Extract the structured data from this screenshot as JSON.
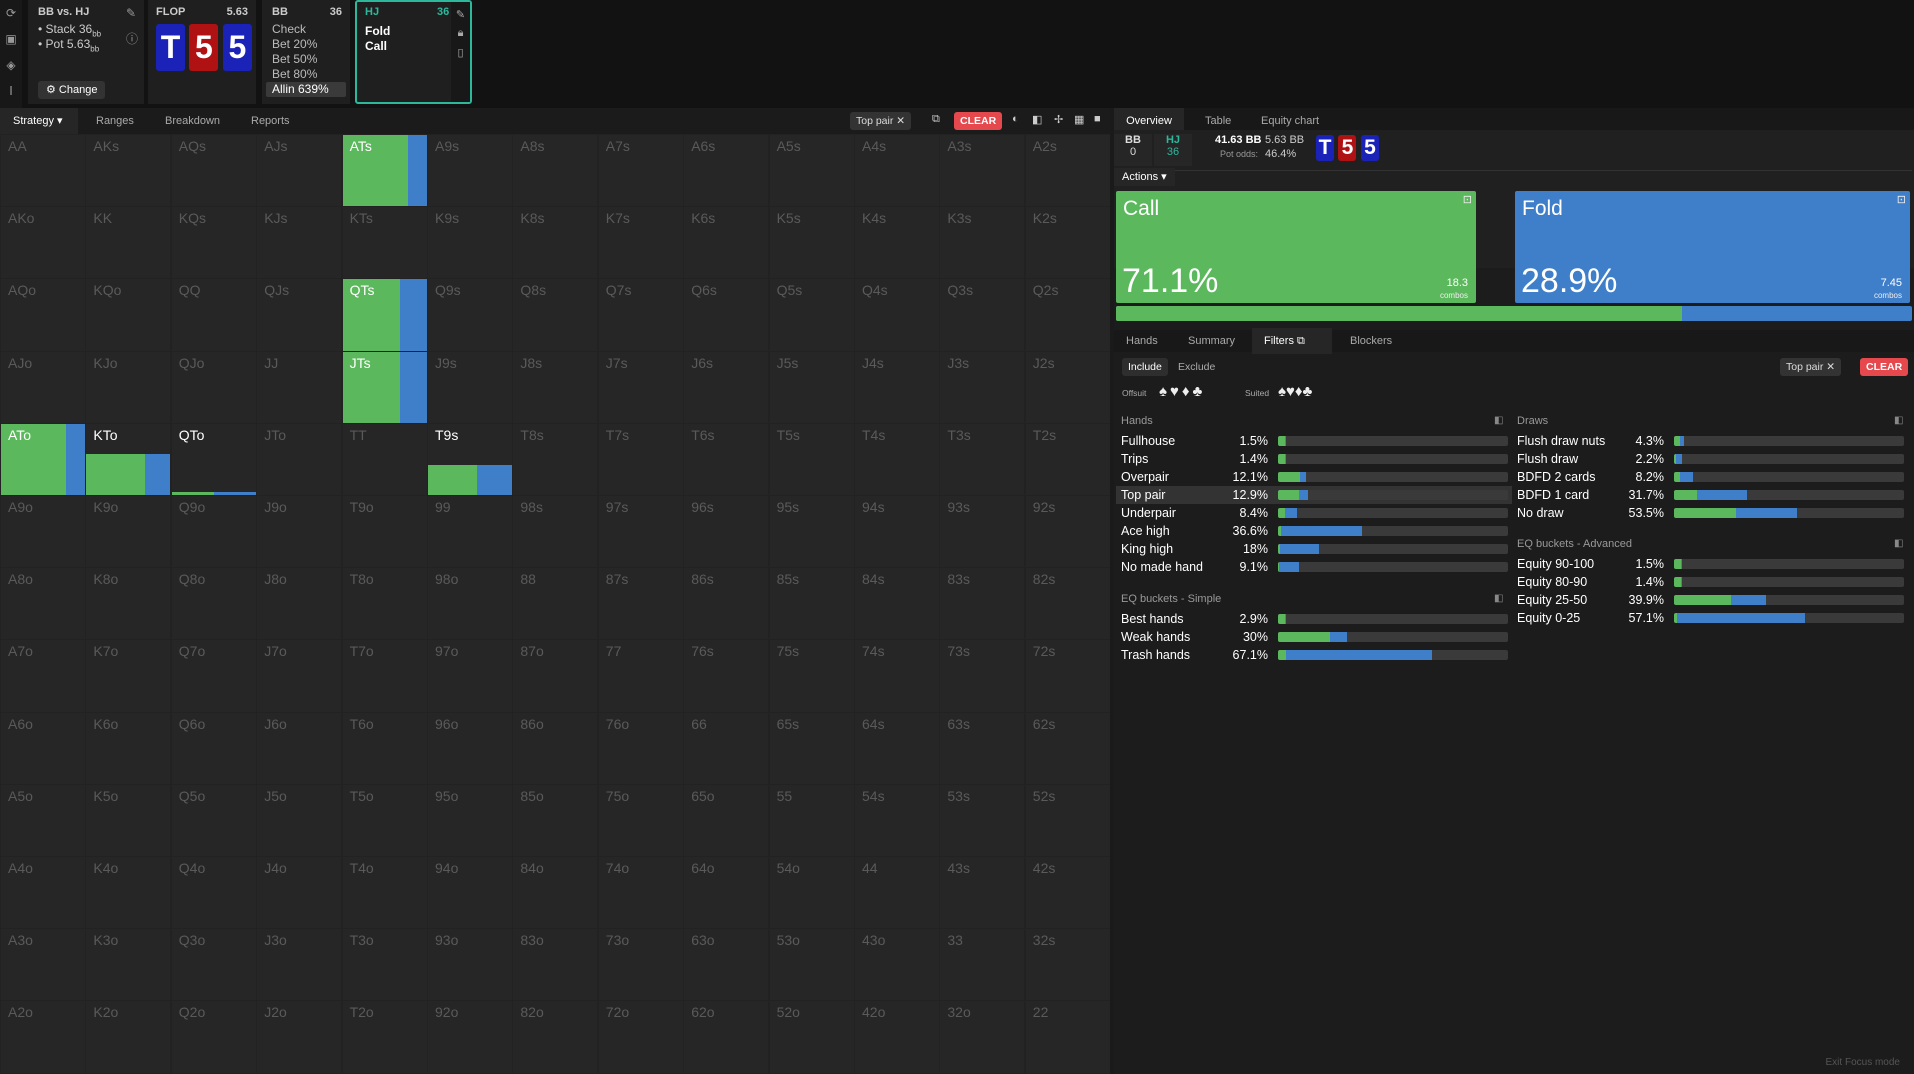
{
  "colors": {
    "call": "#5cb85c",
    "fold": "#3f7ec9",
    "clear": "#e5484d",
    "accent": "#2db89c"
  },
  "left_rail_icons": [
    "refresh-icon",
    "save-icon",
    "gamepad-icon",
    "text-icon"
  ],
  "spot": {
    "title": "BB vs. HJ",
    "stack": "• Stack 36",
    "stack_unit": "bb",
    "pot": "• Pot 5.63",
    "pot_unit": "bb",
    "change": "Change"
  },
  "flop": {
    "label": "FLOP",
    "pot": "5.63",
    "cards": [
      "T",
      "5",
      "5"
    ]
  },
  "bb_box": {
    "label": "BB",
    "stack": "36",
    "actions": [
      "Check",
      "Bet 20%",
      "Bet 50%",
      "Bet 80%",
      "Allin 639%"
    ]
  },
  "hj_box": {
    "label": "HJ",
    "stack": "36",
    "actions": [
      "Fold",
      "Call"
    ]
  },
  "toolbar": {
    "tabs": [
      "Strategy",
      "Ranges",
      "Breakdown",
      "Reports"
    ],
    "filter_chip": "Top pair",
    "clear": "CLEAR"
  },
  "grid": {
    "rows": [
      [
        "AA",
        "AKs",
        "AQs",
        "AJs",
        "ATs",
        "A9s",
        "A8s",
        "A7s",
        "A6s",
        "A5s",
        "A4s",
        "A3s",
        "A2s"
      ],
      [
        "AKo",
        "KK",
        "KQs",
        "KJs",
        "KTs",
        "K9s",
        "K8s",
        "K7s",
        "K6s",
        "K5s",
        "K4s",
        "K3s",
        "K2s"
      ],
      [
        "AQo",
        "KQo",
        "QQ",
        "QJs",
        "QTs",
        "Q9s",
        "Q8s",
        "Q7s",
        "Q6s",
        "Q5s",
        "Q4s",
        "Q3s",
        "Q2s"
      ],
      [
        "AJo",
        "KJo",
        "QJo",
        "JJ",
        "JTs",
        "J9s",
        "J8s",
        "J7s",
        "J6s",
        "J5s",
        "J4s",
        "J3s",
        "J2s"
      ],
      [
        "ATo",
        "KTo",
        "QTo",
        "JTo",
        "TT",
        "T9s",
        "T8s",
        "T7s",
        "T6s",
        "T5s",
        "T4s",
        "T3s",
        "T2s"
      ],
      [
        "A9o",
        "K9o",
        "Q9o",
        "J9o",
        "T9o",
        "99",
        "98s",
        "97s",
        "96s",
        "95s",
        "94s",
        "93s",
        "92s"
      ],
      [
        "A8o",
        "K8o",
        "Q8o",
        "J8o",
        "T8o",
        "98o",
        "88",
        "87s",
        "86s",
        "85s",
        "84s",
        "83s",
        "82s"
      ],
      [
        "A7o",
        "K7o",
        "Q7o",
        "J7o",
        "T7o",
        "97o",
        "87o",
        "77",
        "76s",
        "75s",
        "74s",
        "73s",
        "72s"
      ],
      [
        "A6o",
        "K6o",
        "Q6o",
        "J6o",
        "T6o",
        "96o",
        "86o",
        "76o",
        "66",
        "65s",
        "64s",
        "63s",
        "62s"
      ],
      [
        "A5o",
        "K5o",
        "Q5o",
        "J5o",
        "T5o",
        "95o",
        "85o",
        "75o",
        "65o",
        "55",
        "54s",
        "53s",
        "52s"
      ],
      [
        "A4o",
        "K4o",
        "Q4o",
        "J4o",
        "T4o",
        "94o",
        "84o",
        "74o",
        "64o",
        "54o",
        "44",
        "43s",
        "42s"
      ],
      [
        "A3o",
        "K3o",
        "Q3o",
        "J3o",
        "T3o",
        "93o",
        "83o",
        "73o",
        "63o",
        "53o",
        "43o",
        "33",
        "32s"
      ],
      [
        "A2o",
        "K2o",
        "Q2o",
        "J2o",
        "T2o",
        "92o",
        "82o",
        "72o",
        "62o",
        "52o",
        "42o",
        "32o",
        "22"
      ]
    ],
    "active": [
      {
        "r": 0,
        "c": 4,
        "fill": 1.0,
        "call": 0.77
      },
      {
        "r": 2,
        "c": 4,
        "fill": 1.0,
        "call": 0.68
      },
      {
        "r": 3,
        "c": 4,
        "fill": 1.0,
        "call": 0.68
      },
      {
        "r": 4,
        "c": 0,
        "fill": 1.0,
        "call": 0.77
      },
      {
        "r": 4,
        "c": 1,
        "fill": 0.58,
        "call": 0.7
      },
      {
        "r": 4,
        "c": 2,
        "fill": 0.04,
        "call": 0.5
      },
      {
        "r": 4,
        "c": 5,
        "fill": 0.42,
        "call": 0.58
      }
    ]
  },
  "right": {
    "tabs": [
      "Overview",
      "Table",
      "Equity chart"
    ],
    "bb": {
      "label": "BB",
      "value": "0"
    },
    "hj": {
      "label": "HJ",
      "value": "36"
    },
    "eff": "41.63 BB",
    "pot": "5.63 BB",
    "pot_odds_label": "Pot odds:",
    "pot_odds": "46.4%",
    "board": [
      "T",
      "5",
      "5"
    ],
    "actions_label": "Actions",
    "call": {
      "label": "Call",
      "pct": "71.1%",
      "combos": "18.3",
      "combos_label": "combos",
      "frac": 0.711
    },
    "fold": {
      "label": "Fold",
      "pct": "28.9%",
      "combos": "7.45",
      "combos_label": "combos"
    },
    "subtabs": [
      "Hands",
      "Summary",
      "Filters",
      "Blockers"
    ],
    "include": "Include",
    "exclude": "Exclude",
    "offsuit": "Offsuit",
    "suited": "Suited",
    "filter_chip": "Top pair",
    "clear": "CLEAR",
    "exit": "Exit Focus mode",
    "hands_title": "Hands",
    "draws_title": "Draws",
    "eq_simple_title": "EQ buckets - Simple",
    "eq_adv_title": "EQ buckets - Advanced",
    "hands": [
      {
        "name": "Fullhouse",
        "pct": "1.5%",
        "fill": 0.015,
        "call": 0.9
      },
      {
        "name": "Trips",
        "pct": "1.4%",
        "fill": 0.014,
        "call": 0.9
      },
      {
        "name": "Overpair",
        "pct": "12.1%",
        "fill": 0.121,
        "call": 0.78
      },
      {
        "name": "Top pair",
        "pct": "12.9%",
        "fill": 0.129,
        "call": 0.72
      },
      {
        "name": "Underpair",
        "pct": "8.4%",
        "fill": 0.084,
        "call": 0.35
      },
      {
        "name": "Ace high",
        "pct": "36.6%",
        "fill": 0.366,
        "call": 0.03
      },
      {
        "name": "King high",
        "pct": "18%",
        "fill": 0.18,
        "call": 0.05
      },
      {
        "name": "No made hand",
        "pct": "9.1%",
        "fill": 0.091,
        "call": 0.03
      }
    ],
    "draws": [
      {
        "name": "Flush draw nuts",
        "pct": "4.3%",
        "fill": 0.043,
        "call": 0.6
      },
      {
        "name": "Flush draw",
        "pct": "2.2%",
        "fill": 0.022,
        "call": 0.3
      },
      {
        "name": "BDFD 2 cards",
        "pct": "8.2%",
        "fill": 0.082,
        "call": 0.3
      },
      {
        "name": "BDFD 1 card",
        "pct": "31.7%",
        "fill": 0.317,
        "call": 0.32
      },
      {
        "name": "No draw",
        "pct": "53.5%",
        "fill": 0.535,
        "call": 0.5
      }
    ],
    "eq_simple": [
      {
        "name": "Best hands",
        "pct": "2.9%",
        "fill": 0.029,
        "call": 0.9
      },
      {
        "name": "Weak hands",
        "pct": "30%",
        "fill": 0.3,
        "call": 0.75
      },
      {
        "name": "Trash hands",
        "pct": "67.1%",
        "fill": 0.671,
        "call": 0.05
      }
    ],
    "eq_adv": [
      {
        "name": "Equity 90-100",
        "pct": "1.5%",
        "fill": 0.015,
        "call": 0.9
      },
      {
        "name": "Equity 80-90",
        "pct": "1.4%",
        "fill": 0.014,
        "call": 0.9
      },
      {
        "name": "Equity 25-50",
        "pct": "39.9%",
        "fill": 0.399,
        "call": 0.62
      },
      {
        "name": "Equity 0-25",
        "pct": "57.1%",
        "fill": 0.571,
        "call": 0.02
      }
    ]
  }
}
